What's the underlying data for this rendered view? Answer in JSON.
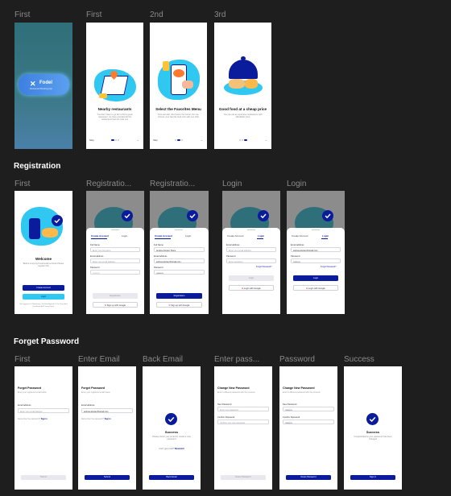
{
  "colors": {
    "canvas": "#1e1e1e",
    "primary": "#0a1b9c",
    "accent": "#30c8f0",
    "splash_top": "#2f6f7a",
    "splash_bottom": "#4a80a8"
  },
  "sections": {
    "registration": "Registration",
    "forget_password": "Forget Password"
  },
  "frame_labels": {
    "onboarding": [
      "First",
      "First",
      "2nd",
      "3rd"
    ],
    "registration": [
      "First",
      "Registratio...",
      "Registratio...",
      "Login",
      "Login"
    ],
    "forget": [
      "First",
      "Enter Email",
      "Back Email",
      "Enter pass...",
      "Password",
      "Success"
    ]
  },
  "splash": {
    "brand": "Fodel",
    "tagline": "Restaurant Booking App"
  },
  "onboarding": [
    {
      "title": "Nearby restaurants",
      "desc": "You don't have to go far to find a good restaurant, we have provided all the restaurants that are near you",
      "skip": "Skip",
      "icon": "map-illustration-icon"
    },
    {
      "title": "Select the Favorites Menu",
      "desc": "Now eat well, don't leave the house,You can choose your favorite food only with one click",
      "skip": "Skip",
      "icon": "phone-menu-illustration-icon"
    },
    {
      "title": "Good food at a cheap price",
      "desc": "You can eat at expensive restaurants with affordable price",
      "icon": "food-cloche-illustration-icon"
    }
  ],
  "welcome": {
    "title": "Welcome",
    "desc": "Before enjoying Foodmedia services Please register first",
    "create_btn": "Create Account",
    "login_btn": "Login",
    "terms": "By Logging In Or Registering, You Have Agreed To The Terms And Conditions And Privacy Policy."
  },
  "register": {
    "tab_create": "Create Account",
    "tab_login": "Login",
    "full_name_label": "Full Name",
    "full_name_ph": "Enter your full name",
    "full_name_val": "Andrew Ainsley Stone",
    "email_label": "Email address",
    "email_ph": "Enter your email address",
    "email_val": "andrew.ainsley@gmail.com",
    "password_label": "Password",
    "password_val": "••••••••••",
    "register_btn": "Registration",
    "google_btn": "Sign up with Google"
  },
  "login": {
    "email_label": "Email address",
    "email_ph": "Enter your email address",
    "email_val": "andrew.ainsley@gmail.com",
    "password_label": "Password",
    "password_ph": "Enter password",
    "password_val": "••••••••••",
    "forgot": "Forgot Password?",
    "login_btn": "Login",
    "google_btn": "Login with Google"
  },
  "forget": {
    "title": "Forget Password",
    "desc": "Enter your registered email below",
    "email_label": "Email address",
    "email_ph": "Enter your email address",
    "email_val": "andrew.ainsley@gmail.com",
    "remember": "Remember the password?",
    "sign_in": "Sign in",
    "submit": "Submit"
  },
  "email_sent": {
    "title": "Success",
    "desc": "Please check your email for create a new password",
    "question": "Can't get email?",
    "resubmit": "Resubmit",
    "back_btn": "Back Email"
  },
  "new_password": {
    "title": "Change New Password",
    "desc": "Enter a different password with the previous",
    "new_label": "New Password",
    "new_ph": "Enter new password",
    "confirm_label": "Confirm Password",
    "confirm_ph": "Confirm your new password",
    "masked": "••••••••••",
    "reset_btn": "Reset Password"
  },
  "success": {
    "title": "Success",
    "desc": "Congratulations your password has been changed",
    "signin_btn": "Sign in"
  }
}
